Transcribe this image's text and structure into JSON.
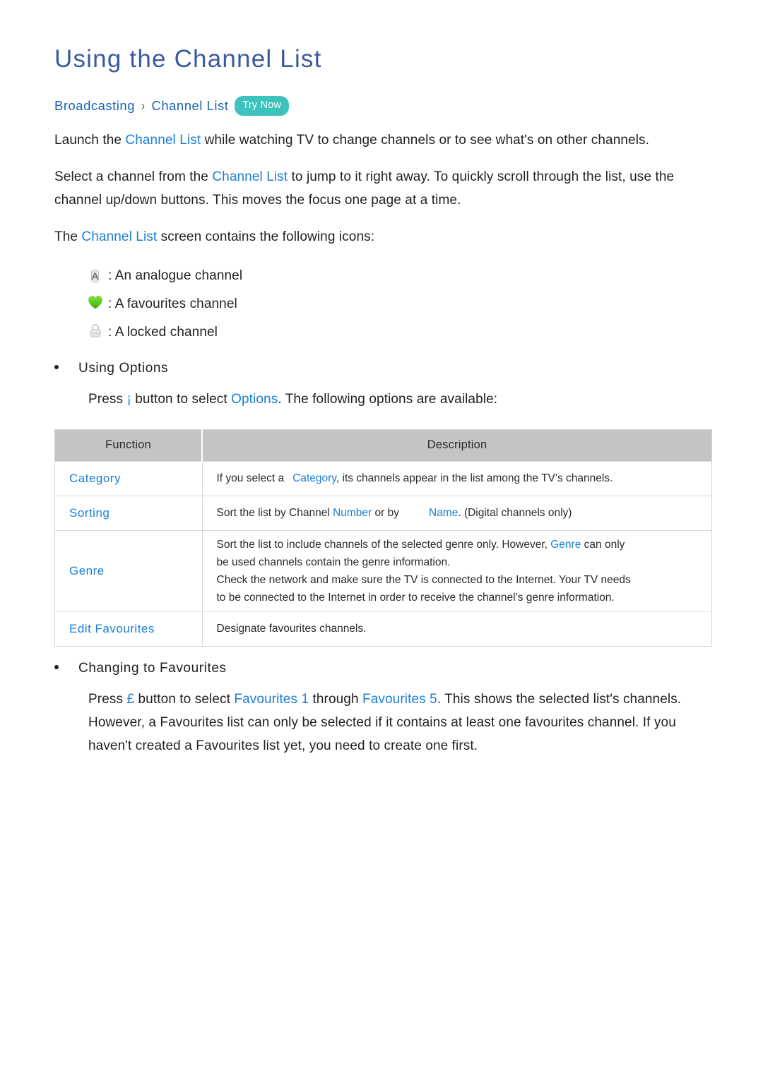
{
  "page": {
    "title": "Using the Channel List"
  },
  "breadcrumb": {
    "root": "Broadcasting",
    "separator": "›",
    "leaf": "Channel List",
    "try_now": "Try Now"
  },
  "intro": {
    "p1_a": "Launch the ",
    "p1_link": "Channel List",
    "p1_b": " while watching TV to change channels or to see what's on other channels.",
    "p2_a": "Select a channel from the ",
    "p2_link": "Channel List",
    "p2_b": " to jump to it right away. To quickly scroll through the list, use the channel up/down buttons. This moves the focus one page at a time.",
    "p3_a": "The ",
    "p3_link": "Channel List",
    "p3_b": " screen contains the following icons:"
  },
  "legend": [
    {
      "icon": "analogue-channel-icon",
      "glyph": "A",
      "text": ": An analogue channel"
    },
    {
      "icon": "favourite-heart-icon",
      "glyph": "",
      "text": ": A favourites channel"
    },
    {
      "icon": "locked-padlock-icon",
      "glyph": "",
      "text": ": A locked channel"
    }
  ],
  "using_options": {
    "heading": "Using Options",
    "press_a": "Press ",
    "key": "¡",
    "press_b": " button to select ",
    "options_link": "Options",
    "press_c": ". The following options are available:"
  },
  "table": {
    "headers": {
      "function": "Function",
      "description": "Description"
    },
    "rows": [
      {
        "function": "Category",
        "lines": [
          {
            "pre": "If you select a",
            "gap": "small",
            "link": "Category",
            "post": ", its channels appear in the list among the TV’s channels."
          }
        ]
      },
      {
        "function": "Sorting",
        "lines": [
          {
            "pre": "Sort the list by Channel ",
            "link_inline": "Number",
            "mid": " or by",
            "gap": "large",
            "link": "Name",
            "post": ". (Digital channels only)"
          }
        ]
      },
      {
        "function": "Genre",
        "lines": [
          {
            "pre": "Sort the list to include channels of the selected genre only. However, ",
            "link_inline": "Genre",
            "post": " can only"
          },
          {
            "pre": "be used channels contain the genre information."
          },
          {
            "pre": "Check the network and make sure the TV is connected to the Internet. Your TV needs"
          },
          {
            "pre": "to be connected to the Internet in order to receive the channel’s genre information."
          }
        ]
      },
      {
        "function": "Edit Favourites",
        "lines": [
          {
            "pre": "Designate favourites channels."
          }
        ]
      }
    ]
  },
  "favourites": {
    "heading": "Changing to Favourites",
    "press_a": "Press ",
    "key": "£",
    "press_b": " button to select ",
    "link1": "Favourites 1",
    "mid": " through ",
    "link2": "Favourites 5",
    "press_c": ". This shows the selected list's channels. However, a Favourites list can only be selected if it contains at least one favourites channel. If you haven't created a Favourites list yet, you need to create one first."
  },
  "colors": {
    "title": "#3b5a9e",
    "link": "#1b7fd4",
    "breadcrumb": "#1b63b5",
    "badge": "#3cc3bd",
    "table_header": "#c4c4c4",
    "heart": "#5fc52a"
  }
}
